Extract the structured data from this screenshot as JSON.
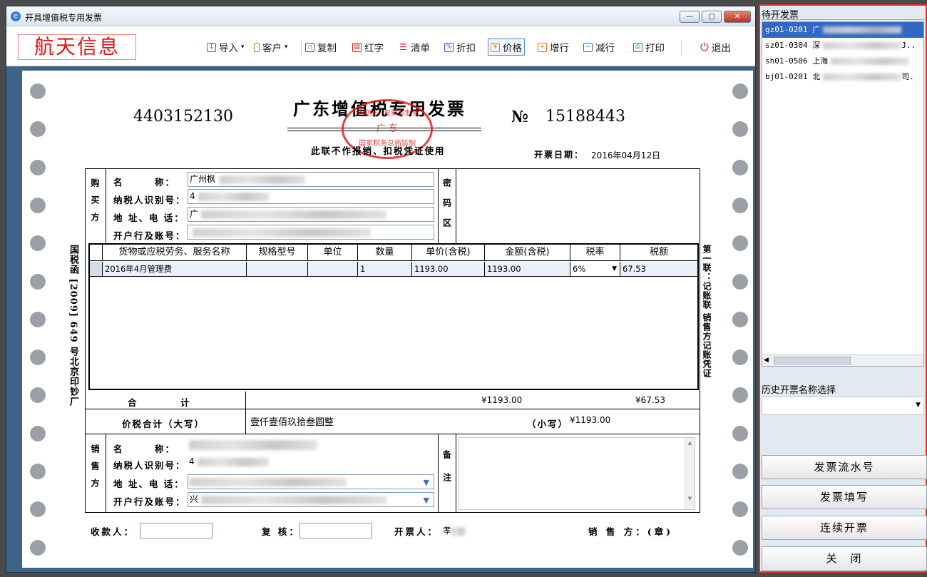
{
  "window": {
    "title": "开具增值税专用发票",
    "controls": {
      "minimize": "—",
      "maximize": "□",
      "close": "✕"
    }
  },
  "toolbar": {
    "logo": "航天信息",
    "items": [
      {
        "label": "导入",
        "icon": "import-icon",
        "dropdown": true
      },
      {
        "label": "客户",
        "icon": "customer-icon",
        "dropdown": true
      },
      {
        "label": "复制",
        "icon": "copy-icon"
      },
      {
        "label": "红字",
        "icon": "red-invoice-icon"
      },
      {
        "label": "清单",
        "icon": "list-icon"
      },
      {
        "label": "折扣",
        "icon": "discount-icon"
      },
      {
        "label": "价格",
        "icon": "price-icon",
        "active": true
      },
      {
        "label": "增行",
        "icon": "add-row-icon"
      },
      {
        "label": "减行",
        "icon": "remove-row-icon"
      },
      {
        "label": "打印",
        "icon": "print-icon"
      },
      {
        "label": "退出",
        "icon": "power-icon"
      }
    ]
  },
  "invoice": {
    "code": "4403152130",
    "title": "广东增值税专用发票",
    "no_symbol": "№",
    "number": "15188443",
    "subtitle": "此联不作报销、扣税凭证使用",
    "stamp": {
      "top": "全国统一发票监制章",
      "mid": "广 东",
      "bottom": "国家税务总局监制"
    },
    "date_label": "开票日期：",
    "date": "2016年04月12日",
    "left_vertical": "国税函 [2009] 649 号北京印钞厂",
    "right_vertical": "第一联：记账联 销售方记账凭证",
    "buyer": {
      "side_label": "购买方",
      "name_label": "名　　　称：",
      "name_value": "广州枫",
      "tax_id_label": "纳税人识别号：",
      "tax_id_value": "4",
      "address_label": "地 址、电 话：",
      "address_value": "广",
      "bank_label": "开户行及账号：",
      "bank_value": ""
    },
    "password_area_label": "密码区",
    "table": {
      "headers": [
        "货物或应税劳务、服务名称",
        "规格型号",
        "单位",
        "数量",
        "单价(含税)",
        "金额(含税)",
        "税率",
        "税额"
      ],
      "rows": [
        {
          "name": "2016年4月管理费",
          "spec": "",
          "unit": "",
          "qty": "1",
          "price": "1193.00",
          "amount": "1193.00",
          "rate": "6%",
          "tax": "67.53"
        }
      ]
    },
    "total_label": "合　　　计",
    "total_amount": "¥1193.00",
    "total_tax": "¥67.53",
    "grand_label": "价税合计（大写）",
    "grand_upper": "壹仟壹佰玖拾叁圆整",
    "grand_lower_label": "（小写）",
    "grand_lower": "¥1193.00",
    "seller": {
      "side_label": "销售方",
      "name_label": "名　　　称：",
      "tax_id_label": "纳税人识别号：",
      "tax_id_value": "4",
      "address_label": "地 址、电 话：",
      "bank_label": "开户行及账号：",
      "bank_value": "兴"
    },
    "remark_label": "备注",
    "payee_label": "收款人：",
    "reviewer_label": "复 核：",
    "drawer_label": "开票人：",
    "drawer_value": "孝",
    "seller_stamp_label": "销 售 方：(章)"
  },
  "right_panel": {
    "pending_title": "待开发票",
    "pending_items": [
      {
        "code": "gz01-0201",
        "name": "广"
      },
      {
        "code": "sz01-0304",
        "name": "深",
        "suffix": "J.."
      },
      {
        "code": "sh01-0506",
        "name": "上海"
      },
      {
        "code": "bj01-0201",
        "name": "北",
        "suffix": "司."
      }
    ],
    "history_label": "历史开票名称选择",
    "history_value": "",
    "buttons": [
      "发票流水号",
      "发票填写",
      "连续开票",
      "关　闭"
    ]
  }
}
